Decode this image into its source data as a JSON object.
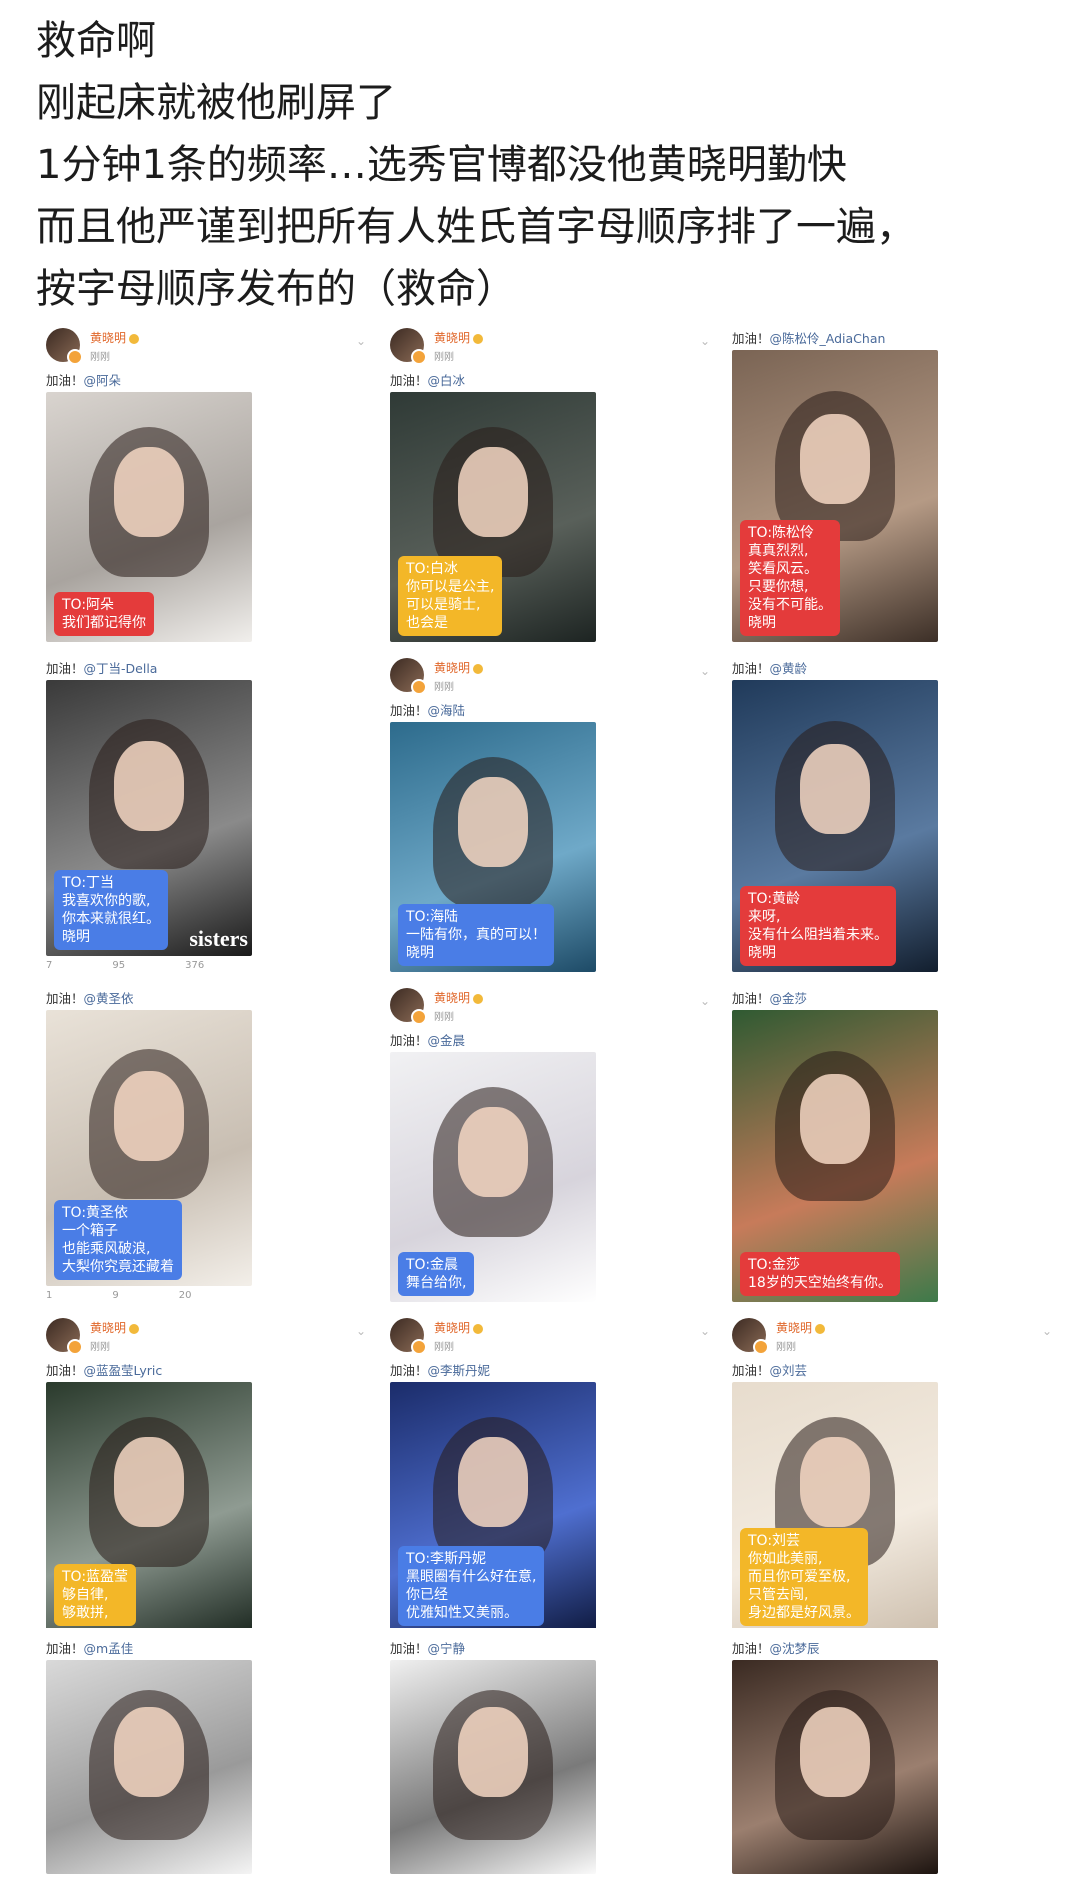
{
  "post": {
    "lines": [
      "救命啊",
      "刚起床就被他刷屏了",
      "1分钟1条的频率…选秀官博都没他黄晓明勤快",
      "而且他严谨到把所有人姓氏首字母顺序排了一遍，",
      "按字母顺序发布的（救命）"
    ]
  },
  "user": {
    "name": "黄晓明",
    "time": "刚刚"
  },
  "cheer_prefix": "加油！",
  "cards": [
    {
      "mention": "@阿朵",
      "bubble": "TO:阿朵\n我们都记得你",
      "bubble_color": "red",
      "header": true
    },
    {
      "mention": "@白冰",
      "bubble": "TO:白冰\n你可以是公主,\n可以是骑士,\n也会是",
      "bubble_color": "yellow",
      "header": true
    },
    {
      "mention": "@陈松伶_AdiaChan",
      "bubble": "TO:陈松伶\n真真烈烈,\n笑看风云。\n只要你想,\n没有不可能。\n晓明",
      "bubble_color": "red",
      "header": false
    },
    {
      "mention": "@丁当-Della",
      "bubble": "TO:丁当\n我喜欢你的歌,\n你本来就很红。\n晓明",
      "bubble_color": "blue",
      "header": false,
      "footer": [
        "7",
        "95",
        "376"
      ],
      "watermark": "sisters"
    },
    {
      "mention": "@海陆",
      "bubble": "TO:海陆\n一陆有你，真的可以！\n晓明",
      "bubble_color": "blue",
      "header": true
    },
    {
      "mention": "@黄龄",
      "bubble": "TO:黄龄\n来呀,\n没有什么阻挡着未来。\n晓明",
      "bubble_color": "red",
      "header": false
    },
    {
      "mention": "@黄圣依",
      "bubble": "TO:黄圣依\n一个箱子\n也能乘风破浪,\n大梨你究竟还藏着",
      "bubble_color": "blue",
      "header": false,
      "footer": [
        "1",
        "9",
        "20"
      ]
    },
    {
      "mention": "@金晨",
      "bubble": "TO:金晨\n舞台给你,",
      "bubble_color": "blue",
      "header": true
    },
    {
      "mention": "@金莎",
      "bubble": "TO:金莎\n18岁的天空始终有你。",
      "bubble_color": "red",
      "header": false
    },
    {
      "mention": "@蓝盈莹Lyric",
      "bubble": "TO:蓝盈莹\n够自律,\n够敢拼,",
      "bubble_color": "yellow",
      "header": true
    },
    {
      "mention": "@李斯丹妮",
      "bubble": "TO:李斯丹妮\n黑眼圈有什么好在意,\n你已经\n优雅知性又美丽。",
      "bubble_color": "blue",
      "header": true
    },
    {
      "mention": "@刘芸",
      "bubble": "TO:刘芸\n你如此美丽,\n而且你可爱至极,\n只管去闯,\n身边都是好风景。",
      "bubble_color": "yellow",
      "header": true
    },
    {
      "mention": "@m孟佳",
      "bubble": "",
      "bubble_color": "",
      "header": false
    },
    {
      "mention": "@宁静",
      "bubble": "",
      "bubble_color": "",
      "header": false
    },
    {
      "mention": "@沈梦辰",
      "bubble": "",
      "bubble_color": "",
      "header": false
    }
  ],
  "colors": {
    "username": "#e0672a",
    "mention": "#4a6a9a",
    "bubble_red": "#e43b3b",
    "bubble_blue": "#4a7de6",
    "bubble_yellow": "#f3b728"
  }
}
